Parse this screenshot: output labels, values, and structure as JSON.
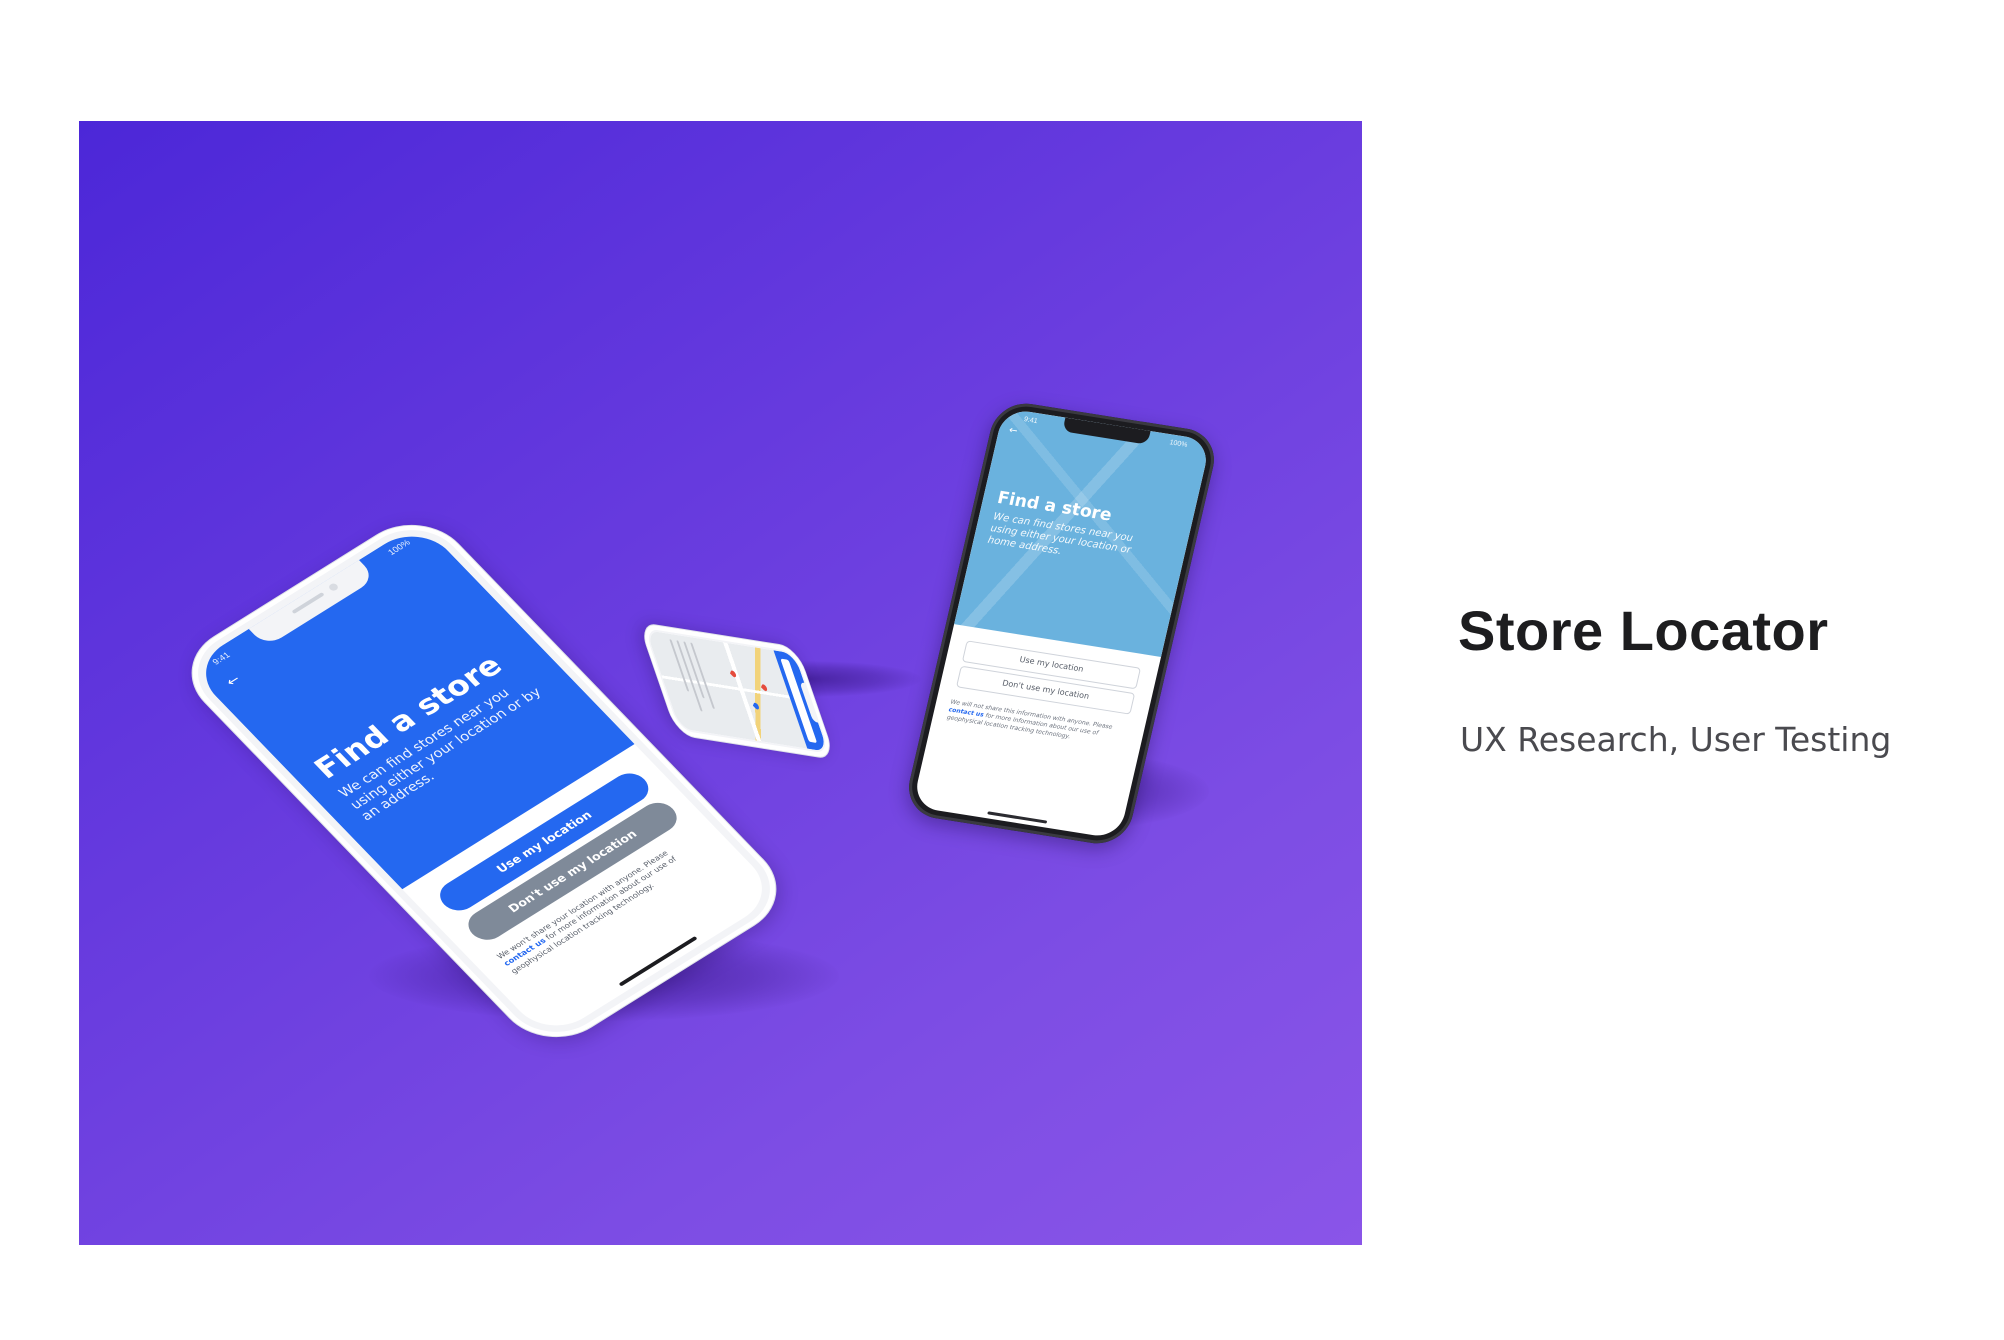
{
  "hero": {
    "gradient_start": "#4c27d8",
    "gradient_end": "#8a55e8"
  },
  "project": {
    "title": "Store Locator",
    "tags": "UX Research, User Testing"
  },
  "phone_front": {
    "frame_color": "#f3f4f7",
    "status_time": "9:41",
    "status_right": "100%",
    "back_icon": "back-arrow-icon",
    "title": "Find a store",
    "subtitle": "We can find stores near you using either your location or by an address.",
    "primary_button": "Use my location",
    "secondary_button": "Don't use my location",
    "disclaimer_lead": "We won't share your location with anyone. Please",
    "disclaimer_link": "contact us",
    "disclaimer_tail": "for more information about our use of geophysical location tracking technology.",
    "accent_color": "#2468f0",
    "secondary_color": "#7f8a99"
  },
  "phone_back": {
    "frame_color": "#1c1c20",
    "status_time": "9:41",
    "status_right": "100%",
    "back_icon": "back-arrow-icon",
    "title": "Find a store",
    "subtitle": "We can find stores near you using either your location or home address.",
    "primary_button": "Use my location",
    "secondary_button": "Don't use my location",
    "disclaimer_lead": "We will not share this information with anyone. Please",
    "disclaimer_link": "contact us",
    "disclaimer_tail": "for more information about our use of geophysical location tracking technology.",
    "map_color": "#6ab2de"
  },
  "phone_small": {
    "frame_color": "#f3f4f7",
    "header_color": "#2468f0"
  }
}
